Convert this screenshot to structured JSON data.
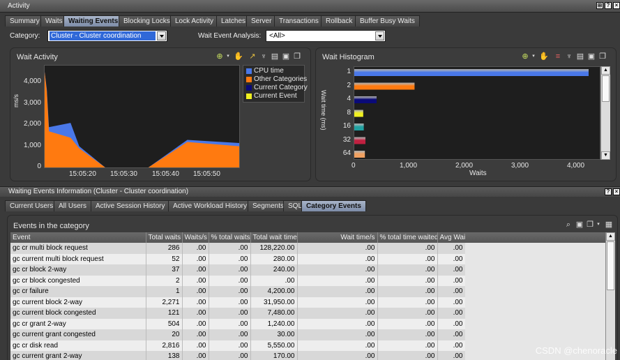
{
  "window": {
    "title": "Activity",
    "buttons": [
      "⊞",
      "?",
      "×"
    ]
  },
  "main_tabs": [
    "Summary",
    "Waits",
    "Waiting Events",
    "Blocking Locks",
    "Lock Activity",
    "Latches",
    "Server",
    "Transactions",
    "Rollback",
    "Buffer Busy Waits"
  ],
  "active_main_tab": "Waiting Events",
  "controls": {
    "category_label": "Category:",
    "category_value": "Cluster - Cluster coordination",
    "analysis_label": "Wait Event Analysis:",
    "analysis_value": "<All>"
  },
  "wait_activity": {
    "title": "Wait Activity",
    "ylabel": "ms/s",
    "colors": {
      "cpu": "#4a78e8",
      "other": "#ff7a10",
      "current_category": "#0a0a78",
      "current_event": "#f0f020"
    }
  },
  "wait_histogram": {
    "title": "Wait Histogram",
    "ylabel": "Wait time (ms)",
    "xlabel": "Waits"
  },
  "chart_data": [
    {
      "type": "area",
      "title": "Wait Activity",
      "ylabel": "ms/s",
      "ylim": [
        0,
        4800
      ],
      "yticks": [
        0,
        1000,
        2000,
        3000,
        4000
      ],
      "ytick_labels": [
        "0",
        "1,000",
        "2,000",
        "3,000",
        "4,000"
      ],
      "xtick_labels": [
        "15:05:20",
        "15:05:30",
        "15:05:40",
        "15:05:50"
      ],
      "x": [
        0,
        0.5,
        1,
        6,
        8,
        14,
        24,
        33,
        45
      ],
      "series": [
        {
          "name": "Other Categories",
          "values": [
            4500,
            3600,
            1700,
            1400,
            900,
            0,
            0,
            1200,
            1000
          ]
        },
        {
          "name": "CPU time",
          "values": [
            4500,
            3700,
            1900,
            2100,
            1000,
            0,
            0,
            1300,
            1150
          ]
        },
        {
          "name": "Current Category",
          "values": [
            0,
            0,
            0,
            0,
            0,
            0,
            0,
            0,
            0
          ]
        },
        {
          "name": "Current Event",
          "values": [
            0,
            0,
            0,
            0,
            0,
            0,
            0,
            0,
            0
          ]
        }
      ],
      "legend": "right"
    },
    {
      "type": "bar",
      "title": "Wait Histogram",
      "orientation": "horizontal",
      "xlabel": "Waits",
      "ylabel": "Wait time (ms)",
      "categories": [
        "1",
        "2",
        "4",
        "8",
        "16",
        "32",
        "64"
      ],
      "values": [
        4200,
        1080,
        400,
        160,
        170,
        200,
        190
      ],
      "colors": [
        "#4a78e8",
        "#ff7a10",
        "#0a0a78",
        "#f0f020",
        "#20a0a0",
        "#c02040",
        "#f0a060"
      ],
      "xlim": [
        0,
        4400
      ],
      "xticks": [
        0,
        1000,
        2000,
        3000,
        4000
      ],
      "xtick_labels": [
        "0",
        "1,000",
        "2,000",
        "3,000",
        "4,000"
      ]
    }
  ],
  "info_section": {
    "title": "Waiting Events Information (Cluster - Cluster coordination)"
  },
  "sub_tabs": [
    "Current Users",
    "All Users",
    "Active Session History",
    "Active Workload History",
    "Segments",
    "SQL",
    "Category Events"
  ],
  "active_sub_tab": "Category Events",
  "events": {
    "title": "Events in the category",
    "columns": [
      "Event",
      "Total waits",
      "Waits/s",
      "% total waits",
      "Total wait time",
      "Wait time/s",
      "% total time waited",
      "Avg Wait"
    ],
    "rows": [
      [
        "gc cr multi block request",
        "286",
        ".00",
        ".00",
        "128,220.00",
        ".00",
        ".00",
        ".00"
      ],
      [
        "gc current multi block request",
        "52",
        ".00",
        ".00",
        "280.00",
        ".00",
        ".00",
        ".00"
      ],
      [
        "gc cr block 2-way",
        "37",
        ".00",
        ".00",
        "240.00",
        ".00",
        ".00",
        ".00"
      ],
      [
        "gc cr block congested",
        "2",
        ".00",
        ".00",
        ".00",
        ".00",
        ".00",
        ".00"
      ],
      [
        "gc cr failure",
        "1",
        ".00",
        ".00",
        "4,200.00",
        ".00",
        ".00",
        ".00"
      ],
      [
        "gc current block 2-way",
        "2,271",
        ".00",
        ".00",
        "31,950.00",
        ".00",
        ".00",
        ".00"
      ],
      [
        "gc current block congested",
        "121",
        ".00",
        ".00",
        "7,480.00",
        ".00",
        ".00",
        ".00"
      ],
      [
        "gc cr grant 2-way",
        "504",
        ".00",
        ".00",
        "1,240.00",
        ".00",
        ".00",
        ".00"
      ],
      [
        "gc current grant congested",
        "20",
        ".00",
        ".00",
        "30.00",
        ".00",
        ".00",
        ".00"
      ],
      [
        "gc cr disk read",
        "2,816",
        ".00",
        ".00",
        "5,550.00",
        ".00",
        ".00",
        ".00"
      ],
      [
        "gc current grant 2-way",
        "138",
        ".00",
        ".00",
        "170.00",
        ".00",
        ".00",
        ".00"
      ]
    ]
  },
  "watermark": "CSDN @chenoracle"
}
